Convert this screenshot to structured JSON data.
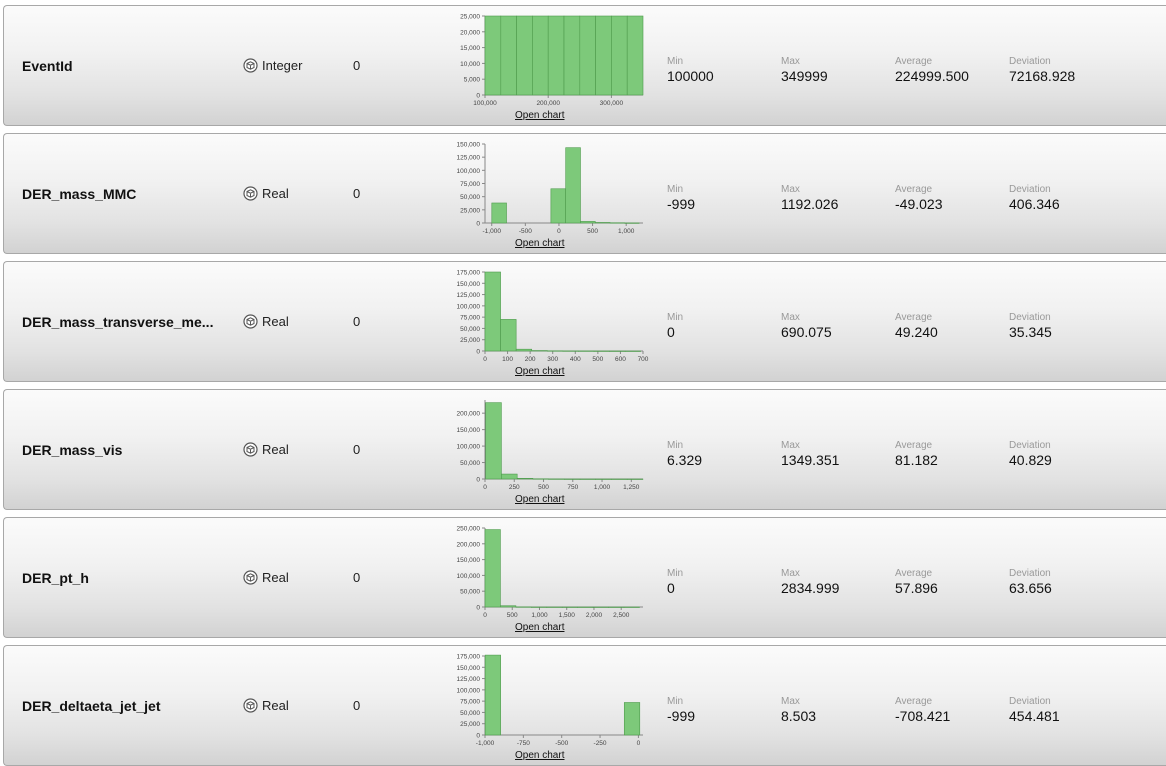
{
  "labels": {
    "min": "Min",
    "max": "Max",
    "average": "Average",
    "deviation": "Deviation",
    "open_chart": "Open chart"
  },
  "icons": {
    "type": "cube-icon"
  },
  "colors": {
    "bar_fill": "#7dc97a",
    "bar_stroke": "#4e9b4c"
  },
  "attributes": [
    {
      "name": "EventId",
      "type": "Integer",
      "missing": "0",
      "min": "100000",
      "max": "349999",
      "average": "224999.500",
      "deviation": "72168.928",
      "histogram": {
        "xlim": [
          100000,
          350000
        ],
        "ylim": [
          0,
          25000
        ],
        "yticks": [
          "0",
          "5,000",
          "10,000",
          "15,000",
          "20,000",
          "25,000"
        ],
        "ytick_values": [
          0,
          5000,
          10000,
          15000,
          20000,
          25000
        ],
        "xticks": [
          "100,000",
          "200,000",
          "300,000"
        ],
        "xtick_values": [
          100000,
          200000,
          300000
        ],
        "bin_edges": [
          100000,
          125000,
          150000,
          175000,
          200000,
          225000,
          250000,
          275000,
          300000,
          325000,
          350000
        ],
        "counts": [
          25000,
          25000,
          25000,
          25000,
          25000,
          25000,
          25000,
          25000,
          25000,
          25000
        ]
      }
    },
    {
      "name": "DER_mass_MMC",
      "type": "Real",
      "missing": "0",
      "min": "-999",
      "max": "1192.026",
      "average": "-49.023",
      "deviation": "406.346",
      "histogram": {
        "xlim": [
          -1100,
          1250
        ],
        "ylim": [
          0,
          150000
        ],
        "yticks": [
          "0",
          "25,000",
          "50,000",
          "75,000",
          "100,000",
          "125,000",
          "150,000"
        ],
        "ytick_values": [
          0,
          25000,
          50000,
          75000,
          100000,
          125000,
          150000
        ],
        "xticks": [
          "-1,000",
          "-500",
          "0",
          "500",
          "1,000"
        ],
        "xtick_values": [
          -1000,
          -500,
          0,
          500,
          1000
        ],
        "bin_edges": [
          -999,
          -780,
          -560,
          -340,
          -120,
          100,
          320,
          540,
          760,
          980,
          1192
        ],
        "counts": [
          38000,
          0,
          0,
          0,
          65000,
          143000,
          3000,
          1000,
          500,
          200
        ]
      }
    },
    {
      "name": "DER_mass_transverse_me...",
      "type": "Real",
      "missing": "0",
      "min": "0",
      "max": "690.075",
      "average": "49.240",
      "deviation": "35.345",
      "histogram": {
        "xlim": [
          0,
          700
        ],
        "ylim": [
          0,
          175000
        ],
        "yticks": [
          "0",
          "25,000",
          "50,000",
          "75,000",
          "100,000",
          "125,000",
          "150,000",
          "175,000"
        ],
        "ytick_values": [
          0,
          25000,
          50000,
          75000,
          100000,
          125000,
          150000,
          175000
        ],
        "xticks": [
          "0",
          "100",
          "200",
          "300",
          "400",
          "500",
          "600",
          "700"
        ],
        "xtick_values": [
          0,
          100,
          200,
          300,
          400,
          500,
          600,
          700
        ],
        "bin_edges": [
          0,
          69,
          138,
          207,
          276,
          345,
          414,
          483,
          552,
          621,
          690
        ],
        "counts": [
          175000,
          70000,
          4000,
          1000,
          500,
          300,
          200,
          100,
          50,
          20
        ]
      }
    },
    {
      "name": "DER_mass_vis",
      "type": "Real",
      "missing": "0",
      "min": "6.329",
      "max": "1349.351",
      "average": "81.182",
      "deviation": "40.829",
      "histogram": {
        "xlim": [
          0,
          1350
        ],
        "ylim": [
          0,
          240000
        ],
        "yticks": [
          "0",
          "50,000",
          "100,000",
          "150,000",
          "200,000"
        ],
        "ytick_values": [
          0,
          50000,
          100000,
          150000,
          200000
        ],
        "xticks": [
          "0",
          "250",
          "500",
          "750",
          "1,000",
          "1,250"
        ],
        "xtick_values": [
          0,
          250,
          500,
          750,
          1000,
          1250
        ],
        "bin_edges": [
          6,
          140,
          275,
          409,
          543,
          678,
          812,
          946,
          1081,
          1215,
          1349
        ],
        "counts": [
          232000,
          15000,
          2000,
          700,
          300,
          100,
          50,
          20,
          10,
          5
        ]
      }
    },
    {
      "name": "DER_pt_h",
      "type": "Real",
      "missing": "0",
      "min": "0",
      "max": "2834.999",
      "average": "57.896",
      "deviation": "63.656",
      "histogram": {
        "xlim": [
          0,
          2900
        ],
        "ylim": [
          0,
          250000
        ],
        "yticks": [
          "0",
          "50,000",
          "100,000",
          "150,000",
          "200,000",
          "250,000"
        ],
        "ytick_values": [
          0,
          50000,
          100000,
          150000,
          200000,
          250000
        ],
        "xticks": [
          "0",
          "500",
          "1,000",
          "1,500",
          "2,000",
          "2,500"
        ],
        "xtick_values": [
          0,
          500,
          1000,
          1500,
          2000,
          2500
        ],
        "bin_edges": [
          0,
          283,
          567,
          850,
          1134,
          1417,
          1701,
          1984,
          2268,
          2551,
          2835
        ],
        "counts": [
          245000,
          4000,
          500,
          100,
          40,
          20,
          10,
          5,
          3,
          2
        ]
      }
    },
    {
      "name": "DER_deltaeta_jet_jet",
      "type": "Real",
      "missing": "0",
      "min": "-999",
      "max": "8.503",
      "average": "-708.421",
      "deviation": "454.481",
      "histogram": {
        "xlim": [
          -1000,
          30
        ],
        "ylim": [
          0,
          175000
        ],
        "yticks": [
          "0",
          "25,000",
          "50,000",
          "75,000",
          "100,000",
          "125,000",
          "150,000",
          "175,000"
        ],
        "ytick_values": [
          0,
          25000,
          50000,
          75000,
          100000,
          125000,
          150000,
          175000
        ],
        "xticks": [
          "-1,000",
          "-750",
          "-500",
          "-250",
          "0"
        ],
        "xtick_values": [
          -1000,
          -750,
          -500,
          -250,
          0
        ],
        "bin_edges": [
          -999,
          -898,
          -797,
          -696,
          -596,
          -495,
          -394,
          -293,
          -192,
          -92,
          9
        ],
        "counts": [
          177000,
          0,
          0,
          0,
          0,
          0,
          0,
          0,
          0,
          72000
        ]
      }
    }
  ]
}
